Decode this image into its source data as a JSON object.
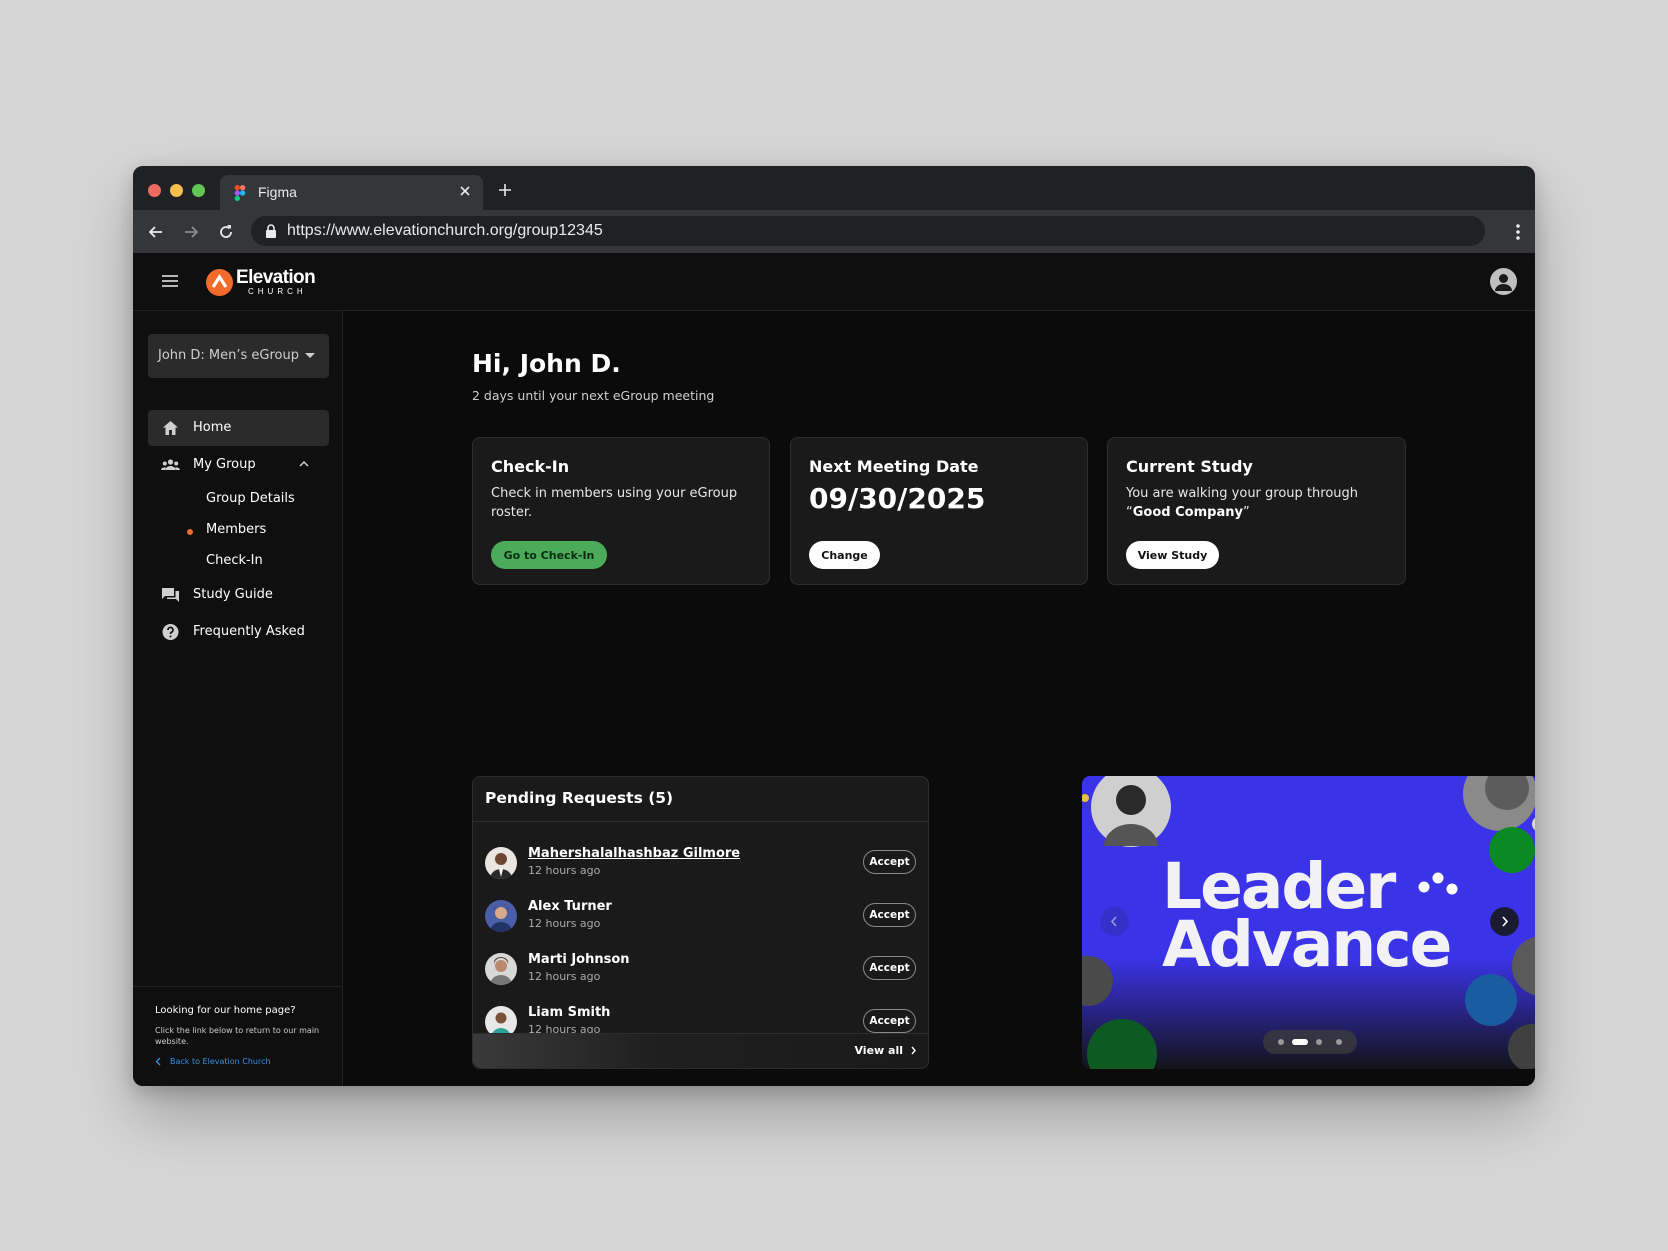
{
  "browser": {
    "tab_title": "Figma",
    "url": "https://www.elevationchurch.org/group12345"
  },
  "header": {
    "logo_name": "Elevation",
    "logo_sub": "CHURCH"
  },
  "sidebar": {
    "group_select": "John D: Men’s eGroup",
    "items": [
      {
        "label": "Home",
        "icon": "home-icon",
        "active": true
      },
      {
        "label": "My Group",
        "icon": "group-icon",
        "expanded": true
      },
      {
        "label": "Study Guide",
        "icon": "chat-icon"
      },
      {
        "label": "Frequently Asked",
        "icon": "help-icon"
      }
    ],
    "subitems": [
      {
        "label": "Group Details"
      },
      {
        "label": "Members",
        "current": true
      },
      {
        "label": "Check-In"
      }
    ],
    "footer": {
      "title": "Looking for our home page?",
      "desc": "Click the link below to return to our main website.",
      "link": "Back to Elevation Church"
    }
  },
  "main": {
    "greeting": "Hi, John D.",
    "subgreeting": "2 days until your next eGroup meeting",
    "cards": {
      "checkin": {
        "title": "Check-In",
        "desc": "Check in members using your eGroup roster.",
        "button": "Go to Check-In"
      },
      "meeting": {
        "title": "Next Meeting Date",
        "date": "09/30/2025",
        "button": "Change"
      },
      "study": {
        "title": "Current Study",
        "desc_prefix": "You are walking your group through “",
        "desc_bold": "Good Company",
        "desc_suffix": "”",
        "button": "View Study"
      }
    },
    "pending": {
      "title": "Pending Requests (5)",
      "accept_label": "Accept",
      "view_all": "View all",
      "requests": [
        {
          "name": "Mahershalalhashbaz Gilmore",
          "time": "12 hours ago"
        },
        {
          "name": "Alex Turner",
          "time": "12 hours ago"
        },
        {
          "name": "Marti Johnson",
          "time": "12 hours ago"
        },
        {
          "name": "Liam Smith",
          "time": "12 hours ago"
        }
      ]
    },
    "banner": {
      "line1": "Leader",
      "line2": "Advance",
      "active_slide": 2,
      "slides": 4
    }
  },
  "colors": {
    "accent": "#f26b2b",
    "checkin_green": "#4cab5b",
    "banner_blue": "#3b33e8",
    "link_blue": "#3d8fe0"
  }
}
